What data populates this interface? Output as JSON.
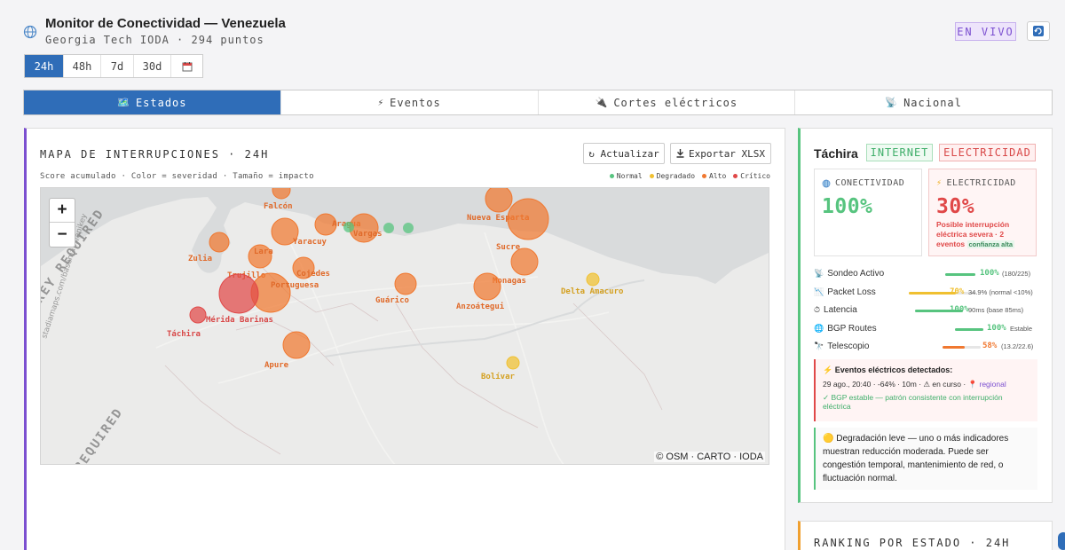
{
  "header": {
    "title": "Monitor de Conectividad — Venezuela",
    "subtitle": "Georgia Tech IODA · 294 puntos",
    "live_label": "EN VIVO"
  },
  "ranges": {
    "items": [
      "24h",
      "48h",
      "7d",
      "30d"
    ],
    "active": "24h",
    "calendar_icon": "calendar-icon"
  },
  "tabs": [
    {
      "label": "Estados",
      "icon": "map-icon",
      "glyph": "🗺️",
      "active": true
    },
    {
      "label": "Eventos",
      "icon": "lightning-icon",
      "glyph": "⚡",
      "active": false
    },
    {
      "label": "Cortes eléctricos",
      "icon": "plug-icon",
      "glyph": "🔌",
      "active": false
    },
    {
      "label": "Nacional",
      "icon": "satellite-icon",
      "glyph": "📡",
      "active": false
    }
  ],
  "map_panel": {
    "title": "MAPA DE INTERRUPCIONES · 24H",
    "subtitle": "Score acumulado · Color = severidad · Tamaño = impacto",
    "refresh_button": "↻ Actualizar",
    "export_button": "Exportar XLSX",
    "legend": [
      {
        "label": "Normal",
        "color": "#57c47f"
      },
      {
        "label": "Degradado",
        "color": "#f0c030"
      },
      {
        "label": "Alto",
        "color": "#f07830"
      },
      {
        "label": "Crítico",
        "color": "#e04848"
      }
    ],
    "zoom_in": "+",
    "zoom_out": "−",
    "attribution": "© OSM · CARTO · IODA",
    "watermark_1": "KEY REQUIRED",
    "watermark_2": "REQUIRED",
    "watermark_url": "stadiamaps.com/basemaps/apikey"
  },
  "map_points": [
    {
      "label": "Falcón",
      "severity": "alto"
    },
    {
      "label": "Yaracuy",
      "severity": "alto"
    },
    {
      "label": "Aragua",
      "severity": "alto"
    },
    {
      "label": "Vargas",
      "severity": "alto"
    },
    {
      "label": "Nueva Esparta",
      "severity": "alto"
    },
    {
      "label": "Sucre",
      "severity": "alto"
    },
    {
      "label": "Zulia",
      "severity": "alto"
    },
    {
      "label": "Lara",
      "severity": "alto"
    },
    {
      "label": "Cojedes",
      "severity": "alto"
    },
    {
      "label": "Trujillo",
      "severity": "alto"
    },
    {
      "label": "Portuguesa",
      "severity": "alto"
    },
    {
      "label": "Monagas",
      "severity": "alto"
    },
    {
      "label": "Delta Amacuro",
      "severity": "degradado"
    },
    {
      "label": "Guárico",
      "severity": "alto"
    },
    {
      "label": "Anzoátegui",
      "severity": "alto"
    },
    {
      "label": "Mérida",
      "severity": "critico"
    },
    {
      "label": "Barinas",
      "severity": "alto"
    },
    {
      "label": "Táchira",
      "severity": "critico"
    },
    {
      "label": "Apure",
      "severity": "alto"
    },
    {
      "label": "Bolívar",
      "severity": "degradado"
    }
  ],
  "state": {
    "name": "Táchira",
    "internet_pill": "INTERNET",
    "electricity_pill": "ELECTRICIDAD",
    "connectivity_label": "CONECTIVIDAD",
    "connectivity_value": "100%",
    "electricity_label": "ELECTRICIDAD",
    "electricity_value": "30%",
    "electricity_note": "Posible interrupción eléctrica severa · 2 eventos",
    "confidence_badge": "confianza alta",
    "metrics": [
      {
        "label": "Sondeo Activo",
        "icon": "antenna-icon",
        "glyph": "📡",
        "pct": "100%",
        "fraction": 1.0,
        "color": "#57c47f",
        "detail": "(180/225)"
      },
      {
        "label": "Packet Loss",
        "icon": "packet-loss-icon",
        "glyph": "📉",
        "pct": "70%",
        "fraction": 0.7,
        "color": "#f0c030",
        "detail": "34.9% (normal <10%)"
      },
      {
        "label": "Latencia",
        "icon": "stopwatch-icon",
        "glyph": "⏱",
        "pct": "100%",
        "fraction": 1.0,
        "color": "#57c47f",
        "detail": "90ms (base 85ms)"
      },
      {
        "label": "BGP Routes",
        "icon": "globe-icon",
        "glyph": "🌐",
        "pct": "100%",
        "fraction": 1.0,
        "color": "#57c47f",
        "detail": "Estable"
      },
      {
        "label": "Telescopio",
        "icon": "telescope-icon",
        "glyph": "🔭",
        "pct": "58%",
        "fraction": 0.58,
        "color": "#f07830",
        "detail": "(13.2/22.6)"
      }
    ],
    "alert_title": "⚡ Eventos eléctricos detectados:",
    "alert_event": "29 ago., 20:40 · -64% · 10m · ⚠ en curso ·",
    "alert_scope": "📍 regional",
    "alert_bgp": "✓ BGP estable — patrón consistente con interrupción eléctrica",
    "info_text": "🟡 Degradación leve — uno o más indicadores muestran reducción moderada. Puede ser congestión temporal, mantenimiento de red, o fluctuación normal."
  },
  "ranking": {
    "title": "RANKING POR ESTADO · 24H"
  }
}
